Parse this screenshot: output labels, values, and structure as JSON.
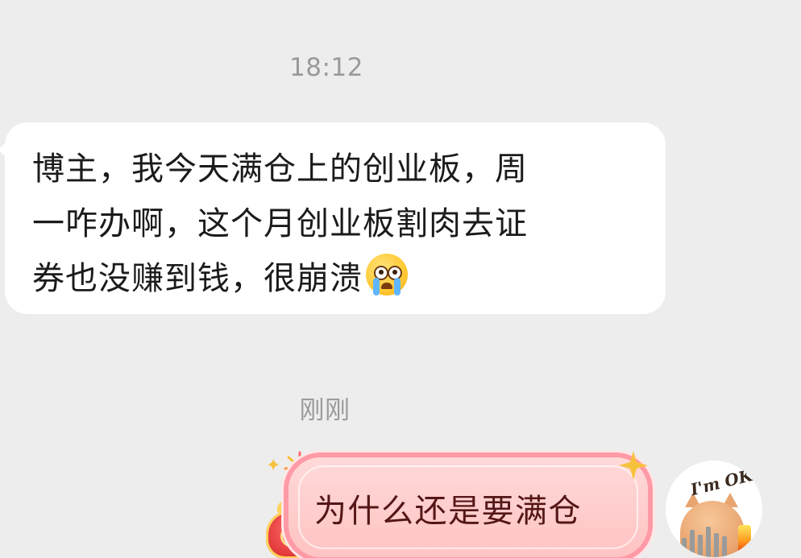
{
  "chat": {
    "timestamp_1": "18:12",
    "incoming_message": {
      "line_1": "博主，我今天满仓上的创业板，周",
      "line_2": "一咋办啊，这个月创业板割肉去证",
      "line_3": "券也没赚到钱，很崩溃",
      "emoji": "loudly-crying-face-icon"
    },
    "timestamp_2": "刚刚",
    "outgoing_message": {
      "text": "为什么还是要满仓",
      "bubble_color": "#ffc9c9",
      "border_color": "#ff9aa6"
    },
    "avatar": {
      "caption": "I'm OK!",
      "icon": "cat-candle-avatar-icon"
    }
  },
  "colors": {
    "background": "#ededed",
    "incoming_bubble": "#ffffff",
    "timestamp_text": "#9a9a9a"
  }
}
